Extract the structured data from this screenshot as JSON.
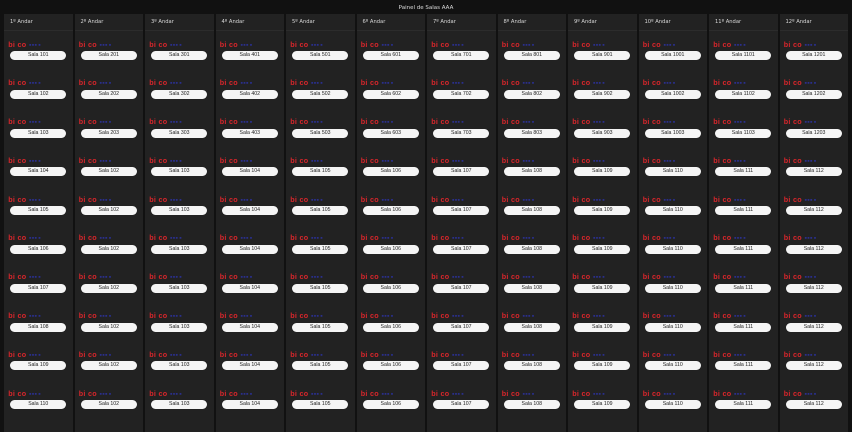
{
  "app": {
    "title": "Painel de Salas AAA"
  },
  "logo": {
    "part1": "bi",
    "part2": "co",
    "part3": "▪▪▪",
    "part4": "▪",
    "brand_red": "#d8262b",
    "brand_blue": "#2a2f8a"
  },
  "floors": [
    {
      "label": "1º Andar",
      "rooms": [
        "Sala 101",
        "Sala 102",
        "Sala 103",
        "Sala 104",
        "Sala 105",
        "Sala 106",
        "Sala 107",
        "Sala 108",
        "Sala 109",
        "Sala 110"
      ]
    },
    {
      "label": "2º Andar",
      "rooms": [
        "Sala 201",
        "Sala 202",
        "Sala 203",
        "Sala 102",
        "Sala 102",
        "Sala 102",
        "Sala 102",
        "Sala 102",
        "Sala 102",
        "Sala 102"
      ]
    },
    {
      "label": "3º Andar",
      "rooms": [
        "Sala 301",
        "Sala 302",
        "Sala 303",
        "Sala 103",
        "Sala 103",
        "Sala 103",
        "Sala 103",
        "Sala 103",
        "Sala 103",
        "Sala 103"
      ]
    },
    {
      "label": "4º Andar",
      "rooms": [
        "Sala 401",
        "Sala 402",
        "Sala 403",
        "Sala 104",
        "Sala 104",
        "Sala 104",
        "Sala 104",
        "Sala 104",
        "Sala 104",
        "Sala 104"
      ]
    },
    {
      "label": "5º Andar",
      "rooms": [
        "Sala 501",
        "Sala 502",
        "Sala 503",
        "Sala 105",
        "Sala 105",
        "Sala 105",
        "Sala 105",
        "Sala 105",
        "Sala 105",
        "Sala 105"
      ]
    },
    {
      "label": "6º Andar",
      "rooms": [
        "Sala 601",
        "Sala 602",
        "Sala 603",
        "Sala 106",
        "Sala 106",
        "Sala 106",
        "Sala 106",
        "Sala 106",
        "Sala 106",
        "Sala 106"
      ]
    },
    {
      "label": "7º Andar",
      "rooms": [
        "Sala 701",
        "Sala 702",
        "Sala 703",
        "Sala 107",
        "Sala 107",
        "Sala 107",
        "Sala 107",
        "Sala 107",
        "Sala 107",
        "Sala 107"
      ]
    },
    {
      "label": "8º Andar",
      "rooms": [
        "Sala 801",
        "Sala 802",
        "Sala 803",
        "Sala 108",
        "Sala 108",
        "Sala 108",
        "Sala 108",
        "Sala 108",
        "Sala 108",
        "Sala 108"
      ]
    },
    {
      "label": "9º Andar",
      "rooms": [
        "Sala 901",
        "Sala 902",
        "Sala 903",
        "Sala 109",
        "Sala 109",
        "Sala 109",
        "Sala 109",
        "Sala 109",
        "Sala 109",
        "Sala 109"
      ]
    },
    {
      "label": "10º Andar",
      "rooms": [
        "Sala 1001",
        "Sala 1002",
        "Sala 1003",
        "Sala 110",
        "Sala 110",
        "Sala 110",
        "Sala 110",
        "Sala 110",
        "Sala 110",
        "Sala 110"
      ]
    },
    {
      "label": "11º Andar",
      "rooms": [
        "Sala 1101",
        "Sala 1102",
        "Sala 1103",
        "Sala 111",
        "Sala 111",
        "Sala 111",
        "Sala 111",
        "Sala 111",
        "Sala 111",
        "Sala 111"
      ]
    },
    {
      "label": "12º Andar",
      "rooms": [
        "Sala 1201",
        "Sala 1202",
        "Sala 1203",
        "Sala 112",
        "Sala 112",
        "Sala 112",
        "Sala 112",
        "Sala 112",
        "Sala 112",
        "Sala 112"
      ]
    }
  ]
}
